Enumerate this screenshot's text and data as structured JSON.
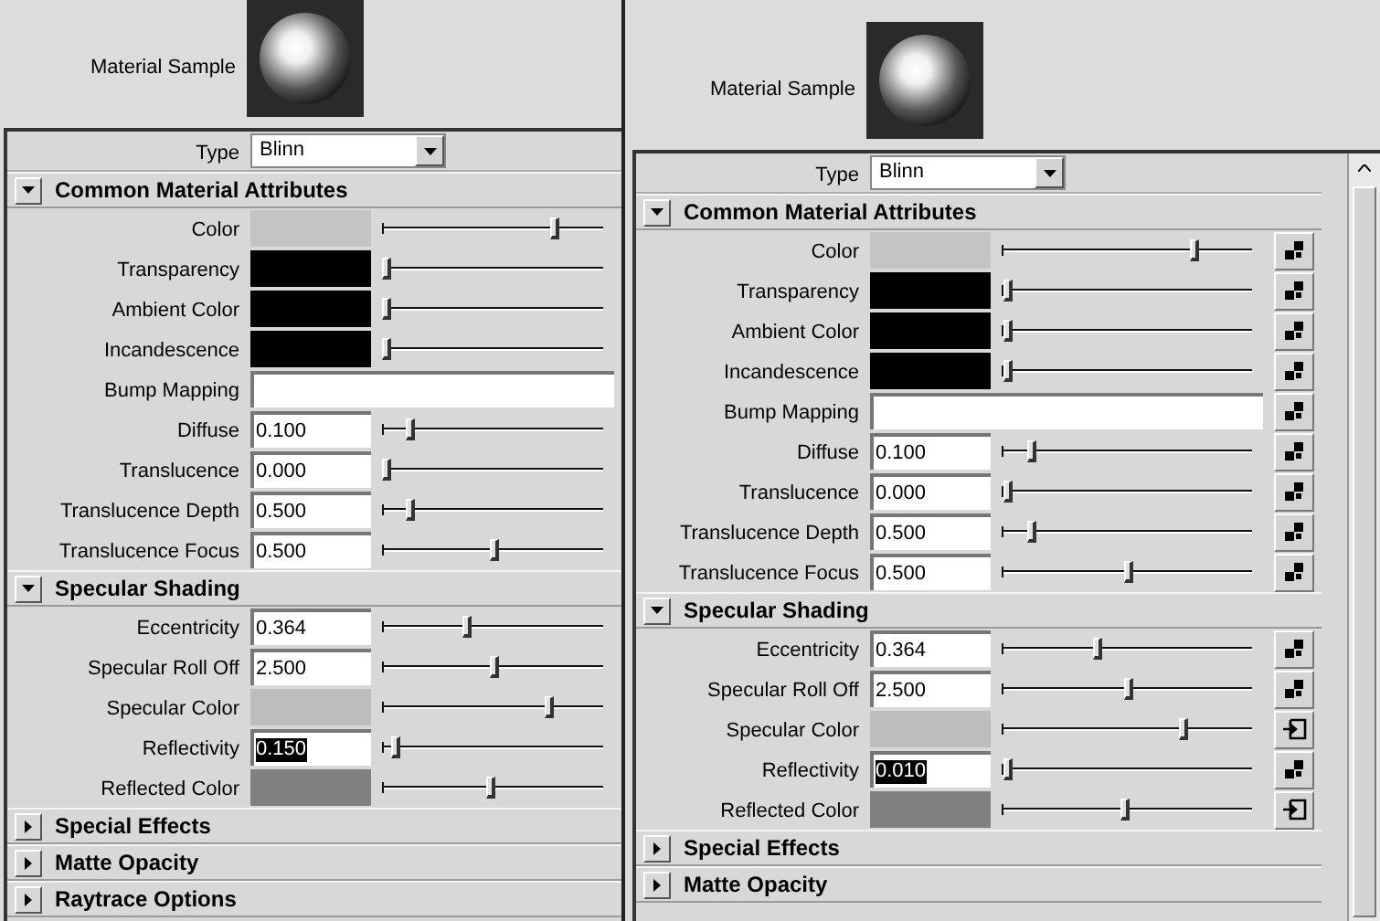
{
  "panels": [
    {
      "sample_label": "Material Sample",
      "type_label": "Type",
      "type_value": "Blinn",
      "scrollbar": false,
      "sections": [
        {
          "title": "Common Material Attributes",
          "expanded": true,
          "attributes": [
            {
              "label": "Color",
              "kind": "color",
              "color": "#c4c4c4",
              "level": 0.78
            },
            {
              "label": "Transparency",
              "kind": "color",
              "color": "#000000",
              "level": 0.02
            },
            {
              "label": "Ambient Color",
              "kind": "color",
              "color": "#000000",
              "level": 0.02
            },
            {
              "label": "Incandescence",
              "kind": "color",
              "color": "#000000",
              "level": 0.02
            },
            {
              "label": "Bump Mapping",
              "kind": "map"
            },
            {
              "label": "Diffuse",
              "kind": "number",
              "value": "0.100",
              "selected": false,
              "level": 0.12
            },
            {
              "label": "Translucence",
              "kind": "number",
              "value": "0.000",
              "selected": false,
              "level": 0.02
            },
            {
              "label": "Translucence Depth",
              "kind": "number",
              "value": "0.500",
              "selected": false,
              "level": 0.12
            },
            {
              "label": "Translucence Focus",
              "kind": "number",
              "value": "0.500",
              "selected": false,
              "level": 0.5
            }
          ]
        },
        {
          "title": "Specular Shading",
          "expanded": true,
          "attributes": [
            {
              "label": "Eccentricity",
              "kind": "number",
              "value": "0.364",
              "selected": false,
              "level": 0.38
            },
            {
              "label": "Specular Roll Off",
              "kind": "number",
              "value": "2.500",
              "selected": false,
              "level": 0.5
            },
            {
              "label": "Specular Color",
              "kind": "color",
              "color": "#bdbdbd",
              "level": 0.75
            },
            {
              "label": "Reflectivity",
              "kind": "number",
              "value": "0.150",
              "selected": true,
              "level": 0.06
            },
            {
              "label": "Reflected Color",
              "kind": "color",
              "color": "#808080",
              "level": 0.49
            }
          ]
        },
        {
          "title": "Special Effects",
          "expanded": false
        },
        {
          "title": "Matte Opacity",
          "expanded": false
        },
        {
          "title": "Raytrace Options",
          "expanded": false
        }
      ]
    },
    {
      "sample_label": "Material Sample",
      "type_label": "Type",
      "type_value": "Blinn",
      "scrollbar": true,
      "sections": [
        {
          "title": "Common Material Attributes",
          "expanded": true,
          "attributes": [
            {
              "label": "Color",
              "kind": "color",
              "color": "#c4c4c4",
              "level": 0.77,
              "connected": false
            },
            {
              "label": "Transparency",
              "kind": "color",
              "color": "#000000",
              "level": 0.02,
              "connected": false
            },
            {
              "label": "Ambient Color",
              "kind": "color",
              "color": "#000000",
              "level": 0.02,
              "connected": false
            },
            {
              "label": "Incandescence",
              "kind": "color",
              "color": "#000000",
              "level": 0.02,
              "connected": false
            },
            {
              "label": "Bump Mapping",
              "kind": "map",
              "connected": false
            },
            {
              "label": "Diffuse",
              "kind": "number",
              "value": "0.100",
              "selected": false,
              "level": 0.12,
              "connected": false
            },
            {
              "label": "Translucence",
              "kind": "number",
              "value": "0.000",
              "selected": false,
              "level": 0.02,
              "connected": false
            },
            {
              "label": "Translucence Depth",
              "kind": "number",
              "value": "0.500",
              "selected": false,
              "level": 0.12,
              "connected": false
            },
            {
              "label": "Translucence Focus",
              "kind": "number",
              "value": "0.500",
              "selected": false,
              "level": 0.5,
              "connected": false
            }
          ]
        },
        {
          "title": "Specular Shading",
          "expanded": true,
          "attributes": [
            {
              "label": "Eccentricity",
              "kind": "number",
              "value": "0.364",
              "selected": false,
              "level": 0.38,
              "connected": false
            },
            {
              "label": "Specular Roll Off",
              "kind": "number",
              "value": "2.500",
              "selected": false,
              "level": 0.5,
              "connected": false
            },
            {
              "label": "Specular Color",
              "kind": "color",
              "color": "#bdbdbd",
              "level": 0.72,
              "connected": true
            },
            {
              "label": "Reflectivity",
              "kind": "number",
              "value": "0.010",
              "selected": true,
              "level": 0.02,
              "connected": false
            },
            {
              "label": "Reflected Color",
              "kind": "color",
              "color": "#808080",
              "level": 0.49,
              "connected": true
            }
          ]
        },
        {
          "title": "Special Effects",
          "expanded": false
        },
        {
          "title": "Matte Opacity",
          "expanded": false
        }
      ]
    }
  ]
}
